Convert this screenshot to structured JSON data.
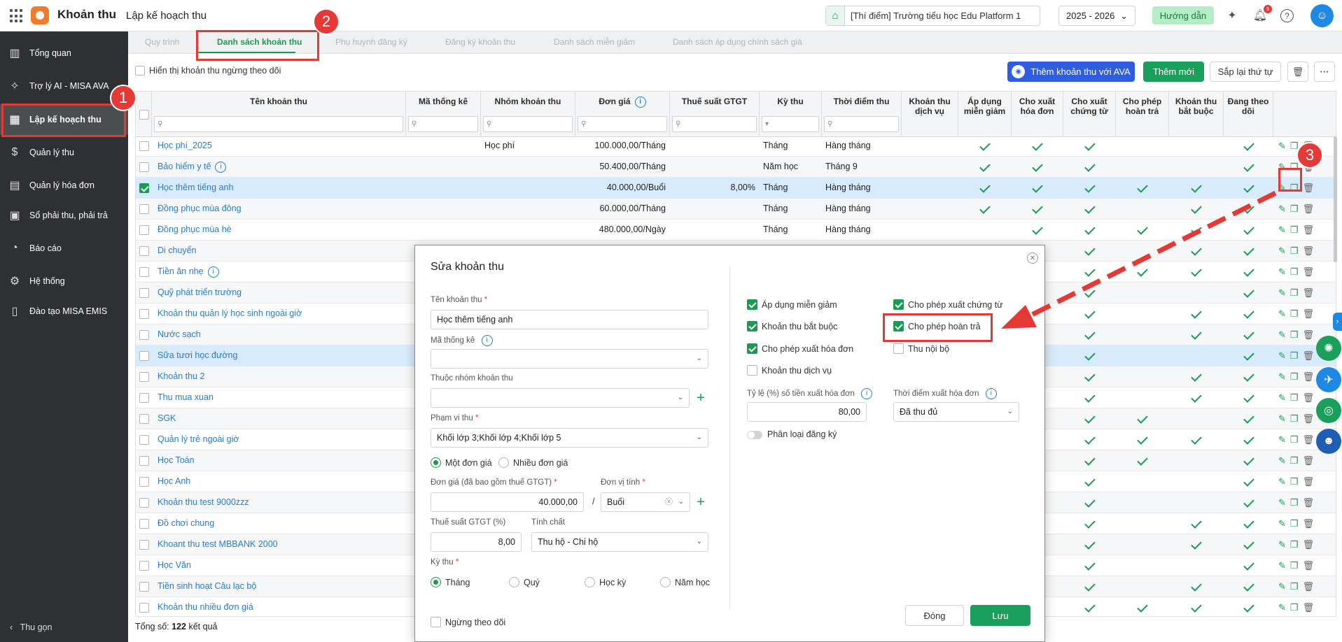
{
  "topbar": {
    "app_name": "Khoản thu",
    "page_title": "Lập kế hoạch thu",
    "school": "[Thí điểm] Trường tiểu học Edu Platform 1",
    "year": "2025 - 2026",
    "guide": "Hướng dẫn",
    "notif_count": "5",
    "icons": [
      "apps-grid-icon",
      "sparkle-icon",
      "bell-icon",
      "help-icon",
      "user-avatar-icon"
    ]
  },
  "sidebar": {
    "items": [
      {
        "label": "Tổng quan",
        "icon": "chart-icon"
      },
      {
        "label": "Trợ lý AI - MISA AVA",
        "icon": "sparkle-icon"
      },
      {
        "label": "Lập kế hoạch thu",
        "icon": "calendar-icon"
      },
      {
        "label": "Quản lý thu",
        "icon": "money-hand-icon"
      },
      {
        "label": "Quản lý hóa đơn",
        "icon": "invoice-icon"
      },
      {
        "label": "Sổ phải thu, phải trả",
        "icon": "ledger-icon"
      },
      {
        "label": "Báo cáo",
        "icon": "pie-chart-icon"
      },
      {
        "label": "Hệ thống",
        "icon": "gear-icon"
      },
      {
        "label": "Đào tạo MISA EMIS",
        "icon": "book-icon"
      }
    ],
    "collapse": "Thu gọn"
  },
  "tabs": [
    "Quy trình",
    "Danh sách khoản thu",
    "Phụ huynh đăng ký",
    "Đăng ký khoản thu",
    "Danh sách miễn giảm",
    "Danh sách áp dụng chính sách giá"
  ],
  "toolbar": {
    "show_inactive": "Hiển thị khoản thu ngừng theo dõi",
    "ava_button": "Thêm khoản thu với AVA",
    "new_button": "Thêm mới",
    "sort_button": "Sắp lại thứ tự"
  },
  "table": {
    "headers": {
      "name": "Tên khoản thu",
      "code": "Mã thống kê",
      "group": "Nhóm khoản thu",
      "price": "Đơn giá",
      "vat": "Thuế suất GTGT",
      "period": "Kỳ thu",
      "time": "Thời điểm thu",
      "service": "Khoản thu dịch vụ",
      "discount": "Áp dụng miễn giảm",
      "invoice": "Cho xuất hóa đơn",
      "voucher": "Cho xuất chứng từ",
      "refund": "Cho phép hoàn trả",
      "required": "Khoản thu bắt buộc",
      "tracking": "Đang theo dõi"
    },
    "rows": [
      {
        "name": "Học phí_2025",
        "group": "Học phí",
        "price": "100.000,00/Tháng",
        "vat": "",
        "period": "Tháng",
        "time": "Hàng tháng",
        "info": false,
        "checked": false,
        "flags": [
          0,
          1,
          1,
          1,
          0,
          0,
          1
        ]
      },
      {
        "name": "Bảo hiểm y tế",
        "group": "",
        "price": "50.400,00/Tháng",
        "vat": "",
        "period": "Năm học",
        "time": "Tháng 9",
        "info": true,
        "checked": false,
        "flags": [
          0,
          1,
          1,
          1,
          0,
          0,
          1
        ]
      },
      {
        "name": "Học thêm tiếng anh",
        "group": "",
        "price": "40.000,00/Buổi",
        "vat": "8,00%",
        "period": "Tháng",
        "time": "Hàng tháng",
        "info": false,
        "checked": true,
        "flags": [
          0,
          1,
          1,
          1,
          1,
          1,
          1
        ]
      },
      {
        "name": "Đồng phục mùa đông",
        "group": "",
        "price": "60.000,00/Tháng",
        "vat": "",
        "period": "Tháng",
        "time": "Hàng tháng",
        "info": false,
        "checked": false,
        "flags": [
          0,
          1,
          1,
          1,
          0,
          1,
          1
        ]
      },
      {
        "name": "Đồng phục mùa hè",
        "group": "",
        "price": "480.000,00/Ngày",
        "vat": "",
        "period": "Tháng",
        "time": "Hàng tháng",
        "info": false,
        "checked": false,
        "flags": [
          0,
          0,
          1,
          1,
          1,
          1,
          1
        ]
      },
      {
        "name": "Di chuyển",
        "group": "",
        "price": "100.000,00/Tháng",
        "vat": "",
        "period": "Tháng",
        "time": "Hàng tháng",
        "info": false,
        "checked": false,
        "flags": [
          0,
          1,
          1,
          1,
          0,
          1,
          1
        ]
      },
      {
        "name": "Tiền ăn nhẹ",
        "info": true,
        "checked": false,
        "flags": [
          0,
          0,
          0,
          1,
          1,
          1,
          1
        ]
      },
      {
        "name": "Quỹ phát triển trường",
        "info": false,
        "checked": false,
        "flags": [
          0,
          0,
          0,
          1,
          0,
          0,
          1
        ]
      },
      {
        "name": "Khoản thu quản lý học sinh ngoài giờ",
        "info": false,
        "checked": false,
        "flags": [
          0,
          0,
          0,
          1,
          0,
          1,
          1
        ]
      },
      {
        "name": "Nước sạch",
        "info": false,
        "checked": false,
        "flags": [
          0,
          0,
          0,
          1,
          0,
          1,
          1
        ]
      },
      {
        "name": "Sữa tươi học đường",
        "info": false,
        "checked": false,
        "flags": [
          0,
          0,
          0,
          1,
          0,
          0,
          1
        ]
      },
      {
        "name": "Khoản thu 2",
        "info": false,
        "checked": false,
        "flags": [
          0,
          0,
          0,
          1,
          0,
          1,
          1
        ]
      },
      {
        "name": "Thu mua xuan",
        "info": false,
        "checked": false,
        "flags": [
          0,
          0,
          0,
          1,
          0,
          1,
          1
        ]
      },
      {
        "name": "SGK",
        "info": false,
        "checked": false,
        "flags": [
          0,
          0,
          0,
          1,
          1,
          0,
          1
        ]
      },
      {
        "name": "Quản lý trẻ ngoài giờ",
        "info": false,
        "checked": false,
        "flags": [
          0,
          0,
          0,
          1,
          1,
          1,
          1
        ]
      },
      {
        "name": "Học Toán",
        "info": false,
        "checked": false,
        "flags": [
          0,
          0,
          0,
          1,
          1,
          0,
          1
        ]
      },
      {
        "name": "Học Anh",
        "info": false,
        "checked": false,
        "flags": [
          0,
          0,
          0,
          1,
          0,
          0,
          1
        ]
      },
      {
        "name": "Khoản thu test 9000zzz",
        "info": false,
        "checked": false,
        "flags": [
          0,
          0,
          0,
          1,
          0,
          0,
          1
        ]
      },
      {
        "name": "Đồ chơi chung",
        "info": false,
        "checked": false,
        "flags": [
          0,
          0,
          0,
          1,
          0,
          1,
          1
        ]
      },
      {
        "name": "Khoant thu test MBBANK 2000",
        "info": false,
        "checked": false,
        "flags": [
          0,
          0,
          0,
          1,
          0,
          1,
          1
        ]
      },
      {
        "name": "Học Văn",
        "info": false,
        "checked": false,
        "flags": [
          0,
          0,
          0,
          1,
          0,
          0,
          1
        ]
      },
      {
        "name": "Tiền sinh hoạt Câu lạc bộ",
        "info": false,
        "checked": false,
        "flags": [
          0,
          0,
          0,
          1,
          0,
          1,
          1
        ]
      },
      {
        "name": "Khoản thu nhiều đơn giá",
        "info": false,
        "checked": false,
        "flags": [
          0,
          0,
          0,
          1,
          1,
          1,
          1
        ]
      },
      {
        "name": "",
        "info": false,
        "checked": false,
        "flags": [
          0,
          0,
          0,
          1,
          0,
          0,
          1
        ]
      }
    ],
    "footer": {
      "label": "Tổng số:",
      "count": "122",
      "suffix": "kết quả"
    }
  },
  "modal": {
    "title": "Sửa khoản thu",
    "name_label": "Tên khoản thu",
    "name_value": "Học thêm tiếng anh",
    "code_label": "Mã thống kê",
    "group_label": "Thuộc nhóm khoản thu",
    "scope_label": "Phạm vi thu",
    "scope_value": "Khối lớp 3;Khối lớp 4;Khối lớp 5",
    "one_price": "Một đơn giá",
    "multi_price": "Nhiều đơn giá",
    "price_label": "Đơn giá (đã bao gồm thuế GTGT)",
    "price_value": "40.000,00",
    "unit_label": "Đơn vị tính",
    "unit_value": "Buổi",
    "vat_label": "Thuế suất GTGT (%)",
    "vat_value": "8,00",
    "nature_label": "Tính chất",
    "nature_value": "Thu hộ - Chi hộ",
    "period_label": "Kỳ thu",
    "periods": [
      "Tháng",
      "Quý",
      "Học kỳ",
      "Năm học"
    ],
    "stop_tracking": "Ngừng theo dõi",
    "checks": {
      "discount": "Áp dụng miễn giảm",
      "voucher": "Cho phép xuất chứng từ",
      "required": "Khoản thu bắt buộc",
      "refund": "Cho phép hoàn trả",
      "invoice": "Cho phép xuất hóa đơn",
      "internal": "Thu nội bộ",
      "service": "Khoản thu dịch vụ"
    },
    "ratio_label": "Tỷ lệ (%) số tiền xuất hóa đơn",
    "ratio_value": "80,00",
    "invoice_time_label": "Thời điểm xuất hóa đơn",
    "invoice_time_value": "Đã thu đủ",
    "classify": "Phân loại đăng ký",
    "close_button": "Đóng",
    "save_button": "Lưu"
  },
  "annotations": [
    "1",
    "2",
    "3"
  ],
  "colors": {
    "accent": "#1a9b52",
    "link": "#1e7fd6",
    "highlight": "#e53935",
    "ava": "#2e5de0"
  }
}
